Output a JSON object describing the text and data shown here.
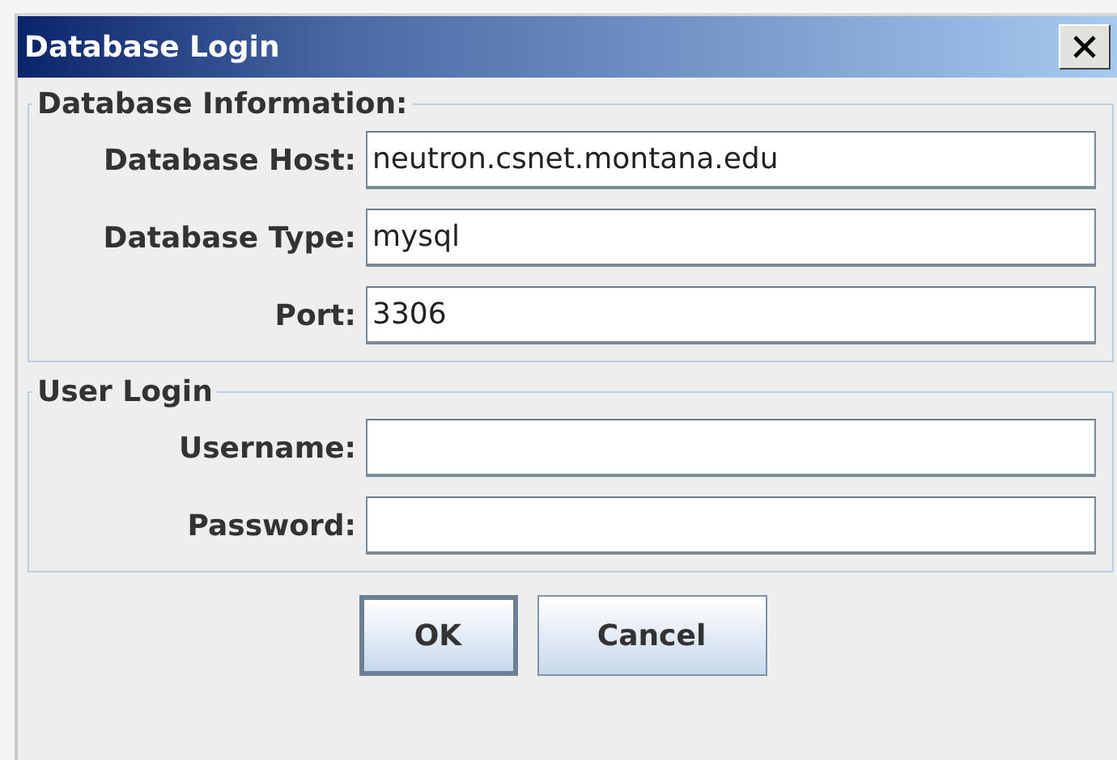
{
  "window": {
    "title": "Database Login"
  },
  "groups": [
    {
      "title": "Database Information:",
      "fields": [
        {
          "label": "Database Host:",
          "value": "neutron.csnet.montana.edu"
        },
        {
          "label": "Database Type:",
          "value": "mysql"
        },
        {
          "label": "Port:",
          "value": "3306"
        }
      ]
    },
    {
      "title": "User Login",
      "fields": [
        {
          "label": "Username:"
        },
        {
          "label": "Password:"
        }
      ]
    }
  ],
  "buttons": [
    {
      "label": "OK",
      "focused": true
    },
    {
      "label": "Cancel",
      "focused": false
    }
  ]
}
